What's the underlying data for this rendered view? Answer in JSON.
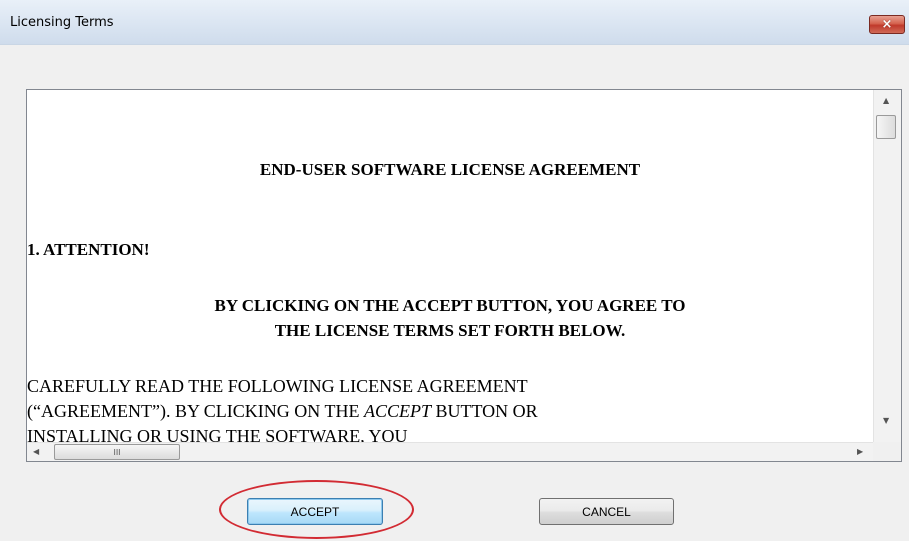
{
  "window": {
    "title": "Licensing Terms",
    "close_glyph": "×",
    "close_icon": "close-icon"
  },
  "license": {
    "heading": "END-USER SOFTWARE LICENSE AGREEMENT",
    "section": "1.  ATTENTION!",
    "notice_line1": "BY CLICKING ON THE ACCEPT BUTTON, YOU AGREE TO",
    "notice_line2": "THE LICENSE TERMS SET FORTH BELOW.",
    "body_line1": "CAREFULLY READ THE FOLLOWING LICENSE AGREEMENT",
    "body_line2_a": "(“AGREEMENT”). BY CLICKING ON THE ",
    "body_line2_em": "ACCEPT",
    "body_line2_b": " BUTTON OR",
    "body_line3": "INSTALLING OR USING THE SOFTWARE, YOU"
  },
  "scrollbars": {
    "up_arrow": "▲",
    "down_arrow": "▼",
    "left_arrow": "◀",
    "right_arrow": "▶",
    "grip": "III"
  },
  "buttons": {
    "accept": "ACCEPT",
    "cancel": "CANCEL"
  },
  "colors": {
    "annotation": "#d22b33",
    "close_button": "#c0392b",
    "accept_border": "#3c7fb1"
  }
}
